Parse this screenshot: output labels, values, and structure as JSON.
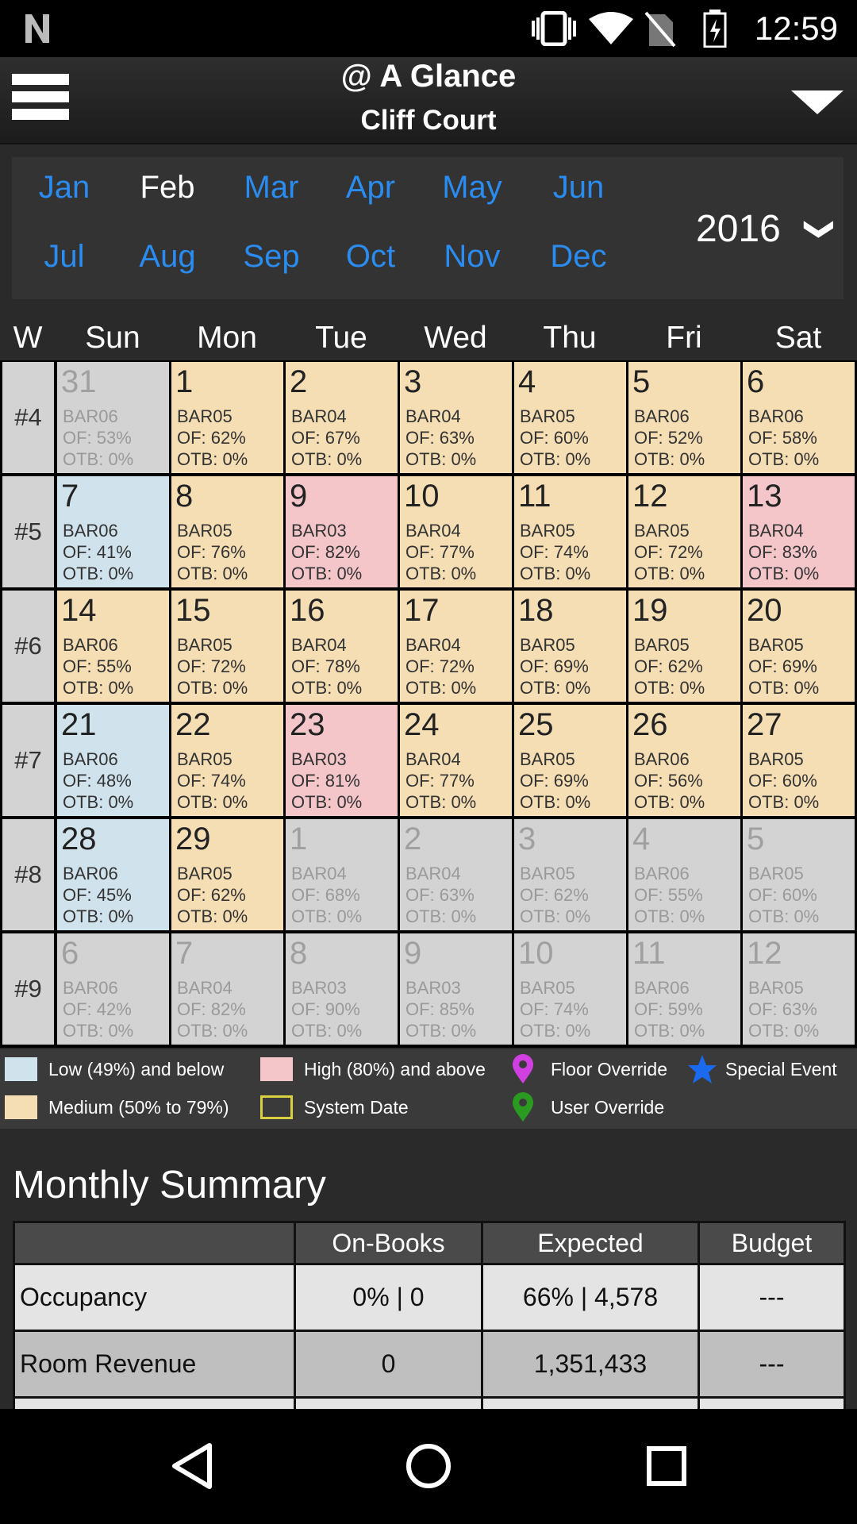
{
  "status_bar": {
    "time": "12:59"
  },
  "header": {
    "title": "@ A Glance",
    "subtitle": "Cliff Court"
  },
  "months": [
    "Jan",
    "Feb",
    "Mar",
    "Apr",
    "May",
    "Jun",
    "Jul",
    "Aug",
    "Sep",
    "Oct",
    "Nov",
    "Dec"
  ],
  "selected_month": "Feb",
  "year": "2016",
  "year_chevron": "❯",
  "day_headers": [
    "W",
    "Sun",
    "Mon",
    "Tue",
    "Wed",
    "Thu",
    "Fri",
    "Sat"
  ],
  "colors": {
    "low": "#d0e3ec",
    "medium": "#f5deb3",
    "high": "#f4c6ca",
    "other": "#d3d3d3",
    "month_link": "#2a8cf0"
  },
  "weeks": [
    {
      "label": "#4",
      "days": [
        {
          "d": "31",
          "bar": "BAR06",
          "of": "OF: 53%",
          "otb": "OTB: 0%",
          "c": "other"
        },
        {
          "d": "1",
          "bar": "BAR05",
          "of": "OF: 62%",
          "otb": "OTB: 0%",
          "c": "medium"
        },
        {
          "d": "2",
          "bar": "BAR04",
          "of": "OF: 67%",
          "otb": "OTB: 0%",
          "c": "medium"
        },
        {
          "d": "3",
          "bar": "BAR04",
          "of": "OF: 63%",
          "otb": "OTB: 0%",
          "c": "medium"
        },
        {
          "d": "4",
          "bar": "BAR05",
          "of": "OF: 60%",
          "otb": "OTB: 0%",
          "c": "medium"
        },
        {
          "d": "5",
          "bar": "BAR06",
          "of": "OF: 52%",
          "otb": "OTB: 0%",
          "c": "medium"
        },
        {
          "d": "6",
          "bar": "BAR06",
          "of": "OF: 58%",
          "otb": "OTB: 0%",
          "c": "medium"
        }
      ]
    },
    {
      "label": "#5",
      "days": [
        {
          "d": "7",
          "bar": "BAR06",
          "of": "OF: 41%",
          "otb": "OTB: 0%",
          "c": "low"
        },
        {
          "d": "8",
          "bar": "BAR05",
          "of": "OF: 76%",
          "otb": "OTB: 0%",
          "c": "medium"
        },
        {
          "d": "9",
          "bar": "BAR03",
          "of": "OF: 82%",
          "otb": "OTB: 0%",
          "c": "high"
        },
        {
          "d": "10",
          "bar": "BAR04",
          "of": "OF: 77%",
          "otb": "OTB: 0%",
          "c": "medium"
        },
        {
          "d": "11",
          "bar": "BAR05",
          "of": "OF: 74%",
          "otb": "OTB: 0%",
          "c": "medium"
        },
        {
          "d": "12",
          "bar": "BAR05",
          "of": "OF: 72%",
          "otb": "OTB: 0%",
          "c": "medium"
        },
        {
          "d": "13",
          "bar": "BAR04",
          "of": "OF: 83%",
          "otb": "OTB: 0%",
          "c": "high"
        }
      ]
    },
    {
      "label": "#6",
      "days": [
        {
          "d": "14",
          "bar": "BAR06",
          "of": "OF: 55%",
          "otb": "OTB: 0%",
          "c": "medium"
        },
        {
          "d": "15",
          "bar": "BAR05",
          "of": "OF: 72%",
          "otb": "OTB: 0%",
          "c": "medium"
        },
        {
          "d": "16",
          "bar": "BAR04",
          "of": "OF: 78%",
          "otb": "OTB: 0%",
          "c": "medium"
        },
        {
          "d": "17",
          "bar": "BAR04",
          "of": "OF: 72%",
          "otb": "OTB: 0%",
          "c": "medium"
        },
        {
          "d": "18",
          "bar": "BAR05",
          "of": "OF: 69%",
          "otb": "OTB: 0%",
          "c": "medium"
        },
        {
          "d": "19",
          "bar": "BAR05",
          "of": "OF: 62%",
          "otb": "OTB: 0%",
          "c": "medium"
        },
        {
          "d": "20",
          "bar": "BAR05",
          "of": "OF: 69%",
          "otb": "OTB: 0%",
          "c": "medium"
        }
      ]
    },
    {
      "label": "#7",
      "days": [
        {
          "d": "21",
          "bar": "BAR06",
          "of": "OF: 48%",
          "otb": "OTB: 0%",
          "c": "low"
        },
        {
          "d": "22",
          "bar": "BAR05",
          "of": "OF: 74%",
          "otb": "OTB: 0%",
          "c": "medium"
        },
        {
          "d": "23",
          "bar": "BAR03",
          "of": "OF: 81%",
          "otb": "OTB: 0%",
          "c": "high"
        },
        {
          "d": "24",
          "bar": "BAR04",
          "of": "OF: 77%",
          "otb": "OTB: 0%",
          "c": "medium"
        },
        {
          "d": "25",
          "bar": "BAR05",
          "of": "OF: 69%",
          "otb": "OTB: 0%",
          "c": "medium"
        },
        {
          "d": "26",
          "bar": "BAR06",
          "of": "OF: 56%",
          "otb": "OTB: 0%",
          "c": "medium"
        },
        {
          "d": "27",
          "bar": "BAR05",
          "of": "OF: 60%",
          "otb": "OTB: 0%",
          "c": "medium"
        }
      ]
    },
    {
      "label": "#8",
      "days": [
        {
          "d": "28",
          "bar": "BAR06",
          "of": "OF: 45%",
          "otb": "OTB: 0%",
          "c": "low"
        },
        {
          "d": "29",
          "bar": "BAR05",
          "of": "OF: 62%",
          "otb": "OTB: 0%",
          "c": "medium"
        },
        {
          "d": "1",
          "bar": "BAR04",
          "of": "OF: 68%",
          "otb": "OTB: 0%",
          "c": "other"
        },
        {
          "d": "2",
          "bar": "BAR04",
          "of": "OF: 63%",
          "otb": "OTB: 0%",
          "c": "other"
        },
        {
          "d": "3",
          "bar": "BAR05",
          "of": "OF: 62%",
          "otb": "OTB: 0%",
          "c": "other"
        },
        {
          "d": "4",
          "bar": "BAR06",
          "of": "OF: 55%",
          "otb": "OTB: 0%",
          "c": "other"
        },
        {
          "d": "5",
          "bar": "BAR05",
          "of": "OF: 60%",
          "otb": "OTB: 0%",
          "c": "other"
        }
      ]
    },
    {
      "label": "#9",
      "days": [
        {
          "d": "6",
          "bar": "BAR06",
          "of": "OF: 42%",
          "otb": "OTB: 0%",
          "c": "other"
        },
        {
          "d": "7",
          "bar": "BAR04",
          "of": "OF: 82%",
          "otb": "OTB: 0%",
          "c": "other"
        },
        {
          "d": "8",
          "bar": "BAR03",
          "of": "OF: 90%",
          "otb": "OTB: 0%",
          "c": "other"
        },
        {
          "d": "9",
          "bar": "BAR03",
          "of": "OF: 85%",
          "otb": "OTB: 0%",
          "c": "other"
        },
        {
          "d": "10",
          "bar": "BAR05",
          "of": "OF: 74%",
          "otb": "OTB: 0%",
          "c": "other"
        },
        {
          "d": "11",
          "bar": "BAR06",
          "of": "OF: 59%",
          "otb": "OTB: 0%",
          "c": "other"
        },
        {
          "d": "12",
          "bar": "BAR05",
          "of": "OF: 63%",
          "otb": "OTB: 0%",
          "c": "other"
        }
      ]
    }
  ],
  "legend": {
    "low": "Low (49%) and below",
    "high": "High (80%) and above",
    "floor_override": "Floor Override",
    "special_event": "Special Event",
    "medium": "Medium (50% to 79%)",
    "system_date": "System Date",
    "user_override": "User Override"
  },
  "summary": {
    "title": "Monthly Summary",
    "headers": [
      "",
      "On-Books",
      "Expected",
      "Budget"
    ],
    "rows": [
      {
        "label": "Occupancy",
        "on_books": "0% | 0",
        "expected": "66% | 4,578",
        "budget": "---"
      },
      {
        "label": "Room Revenue",
        "on_books": "0",
        "expected": "1,351,433",
        "budget": "---"
      }
    ]
  }
}
